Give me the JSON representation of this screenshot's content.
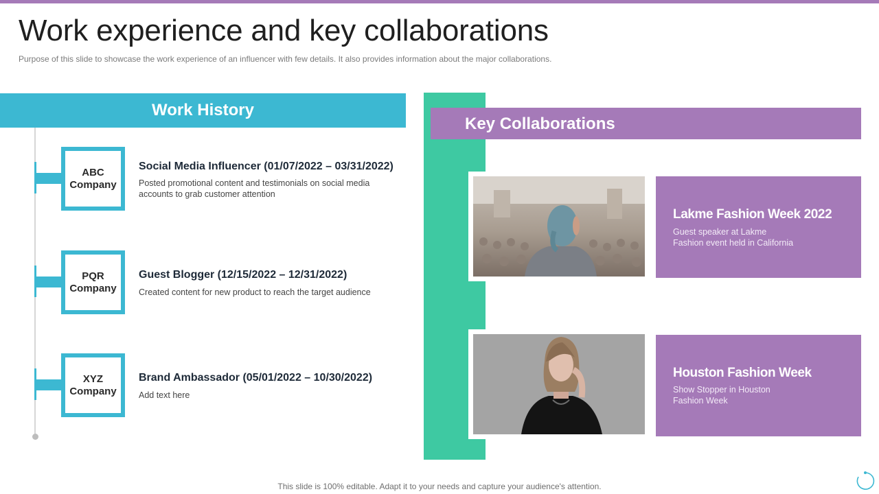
{
  "page": {
    "title": "Work experience and key collaborations",
    "subtitle": "Purpose of this slide to showcase the work experience of an influencer with few details. It also provides  information about the major collaborations.",
    "footer": "This slide is 100% editable. Adapt it to your needs and capture your audience's attention."
  },
  "work_history": {
    "header": "Work History",
    "items": [
      {
        "company": "ABC\nCompany",
        "role": "Social Media Influencer (01/07/2022 – 03/31/2022)",
        "description": "Posted promotional content and testimonials on social media accounts to grab customer attention"
      },
      {
        "company": "PQR\nCompany",
        "role": "Guest Blogger (12/15/2022 – 12/31/2022)",
        "description": "Created content for new product to reach the target audience"
      },
      {
        "company": "XYZ\nCompany",
        "role": "Brand Ambassador (05/01/2022 – 10/30/2022)",
        "description": "Add text here"
      }
    ]
  },
  "key_collaborations": {
    "header": "Key Collaborations",
    "items": [
      {
        "title": "Lakme Fashion Week 2022",
        "description": "Guest speaker at Lakme\nFashion event  held in California",
        "image": "speaker-at-event-photo"
      },
      {
        "title": "Houston Fashion Week",
        "description": "Show Stopper in Houston\nFashion Week",
        "image": "woman-portrait-photo"
      }
    ]
  },
  "colors": {
    "purple": "#a57ab8",
    "blue": "#3cb8d2",
    "green": "#3ec9a2"
  },
  "icons": {
    "corner": "refresh-icon"
  }
}
